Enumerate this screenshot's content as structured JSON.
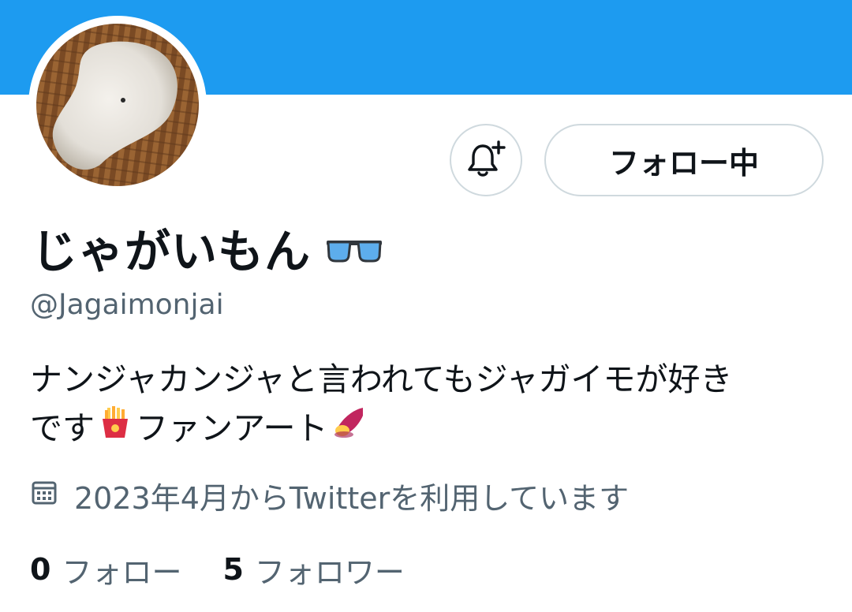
{
  "profile": {
    "display_name": "じゃがいもん",
    "name_emoji_icon": "sunglasses-icon",
    "handle": "@Jagaimonjai",
    "bio": {
      "line1": "ナンジャカンジャと言われてもジャガイモが好き",
      "line2_a": "です",
      "line2_icon": "french-fries-icon",
      "line2_b": "ファンアート",
      "line2_end_icon": "sweet-potato-icon"
    },
    "joined": "2023年4月からTwitterを利用しています",
    "joined_icon": "calendar-icon"
  },
  "actions": {
    "notify_icon": "bell-plus-icon",
    "follow_label": "フォロー中"
  },
  "stats": {
    "following_count": "0",
    "following_label": "フォロー",
    "followers_count": "5",
    "followers_label": "フォロワー"
  },
  "colors": {
    "banner": "#1d9bf0",
    "text_primary": "#0f1419",
    "text_secondary": "#536471",
    "border": "#cfd9de"
  }
}
